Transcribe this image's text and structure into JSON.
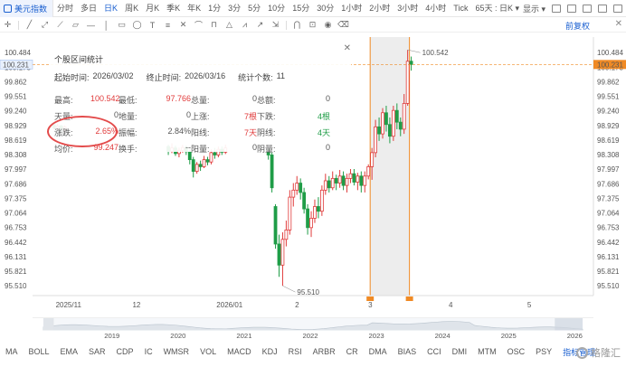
{
  "topbar": {
    "symbol": "美元指数",
    "periods": [
      {
        "label": "分时",
        "active": false
      },
      {
        "label": "多日",
        "active": false
      },
      {
        "label": "日K",
        "active": true
      },
      {
        "label": "周K",
        "active": false
      },
      {
        "label": "月K",
        "active": false
      },
      {
        "label": "季K",
        "active": false
      },
      {
        "label": "年K",
        "active": false
      },
      {
        "label": "1分",
        "active": false
      },
      {
        "label": "3分",
        "active": false
      },
      {
        "label": "5分",
        "active": false
      },
      {
        "label": "10分",
        "active": false
      },
      {
        "label": "15分",
        "active": false
      },
      {
        "label": "30分",
        "active": false
      },
      {
        "label": "1小时",
        "active": false
      },
      {
        "label": "2小时",
        "active": false
      },
      {
        "label": "3小时",
        "active": false
      },
      {
        "label": "4小时",
        "active": false
      },
      {
        "label": "Tick",
        "active": false
      },
      {
        "label": "65天 : 日K ▾",
        "active": false
      }
    ],
    "display_label": "显示 ▾"
  },
  "toolbar": {
    "fuquan_label": "前复权"
  },
  "stats_panel": {
    "title": "个股区间统计",
    "start_label": "起始时间:",
    "start_value": "2026/03/02",
    "end_label": "终止时间:",
    "end_value": "2026/03/16",
    "count_label": "统计个数:",
    "count_value": "11",
    "rows": [
      [
        {
          "k": "最高:",
          "v": "100.542",
          "c": "red"
        },
        {
          "k": "最低:",
          "v": "97.766",
          "c": "red"
        },
        {
          "k": "总量:",
          "v": "0",
          "c": ""
        },
        {
          "k": "总额:",
          "v": "0",
          "c": ""
        }
      ],
      [
        {
          "k": "天量:",
          "v": "0",
          "c": ""
        },
        {
          "k": "地量:",
          "v": "0",
          "c": ""
        },
        {
          "k": "上涨:",
          "v": "7根",
          "c": "red"
        },
        {
          "k": "下跌:",
          "v": "4根",
          "c": "green"
        }
      ],
      [
        {
          "k": "涨跌:",
          "v": "2.65%",
          "c": "red"
        },
        {
          "k": "振幅:",
          "v": "2.84%",
          "c": ""
        },
        {
          "k": "阳线:",
          "v": "7天",
          "c": "red"
        },
        {
          "k": "阴线:",
          "v": "4天",
          "c": "green"
        }
      ],
      [
        {
          "k": "均价:",
          "v": "99.247",
          "c": "red"
        },
        {
          "k": "换手:",
          "v": "--",
          "c": ""
        },
        {
          "k": "阳量:",
          "v": "0",
          "c": ""
        },
        {
          "k": "阴量:",
          "v": "0",
          "c": ""
        }
      ]
    ]
  },
  "chart_data": {
    "type": "candlestick",
    "y_ticks": [
      "100.484",
      "100.173",
      "99.862",
      "99.551",
      "99.240",
      "98.929",
      "98.619",
      "98.308",
      "97.997",
      "97.686",
      "97.375",
      "97.064",
      "96.753",
      "96.442",
      "96.131",
      "95.821",
      "95.510"
    ],
    "ylim": [
      95.3,
      100.7
    ],
    "current_price": "100.231",
    "high_label": "100.542",
    "low_label": "95.510",
    "x_labels": [
      {
        "label": "2025/11",
        "x": 0
      },
      {
        "label": "12",
        "x": 21.5
      },
      {
        "label": "2026/01",
        "x": 45
      },
      {
        "label": "2",
        "x": 67
      },
      {
        "label": "3",
        "x": 87.5
      },
      {
        "label": "4",
        "x": 110
      },
      {
        "label": "5",
        "x": 132
      }
    ],
    "xlim": [
      -8,
      149
    ],
    "candles": [
      [
        -2,
        98.95,
        98.88,
        98.97,
        98.85
      ],
      [
        -1,
        98.88,
        98.92,
        98.96,
        98.83
      ],
      [
        0,
        98.92,
        98.85,
        98.94,
        98.8
      ],
      [
        1,
        98.85,
        98.9,
        98.93,
        98.78
      ],
      [
        30,
        98.48,
        98.38,
        98.52,
        98.3
      ],
      [
        31,
        98.38,
        98.45,
        98.55,
        98.34
      ],
      [
        32,
        98.45,
        98.33,
        98.5,
        98.28
      ],
      [
        33,
        98.33,
        98.4,
        98.46,
        98.25
      ],
      [
        34,
        98.4,
        98.46,
        98.52,
        98.35
      ],
      [
        35,
        98.46,
        98.37,
        98.5,
        98.3
      ],
      [
        36,
        98.37,
        98.2,
        98.42,
        98.1
      ],
      [
        37,
        98.2,
        97.95,
        98.26,
        97.82
      ],
      [
        38,
        97.95,
        98.1,
        98.15,
        97.9
      ],
      [
        39,
        98.1,
        98.05,
        98.18,
        97.96
      ],
      [
        40,
        98.05,
        98.2,
        98.28,
        98.02
      ],
      [
        41,
        98.2,
        98.15,
        98.26,
        98.08
      ],
      [
        42,
        98.15,
        98.35,
        98.42,
        98.1
      ],
      [
        43,
        98.35,
        98.3,
        98.45,
        98.22
      ],
      [
        44,
        98.3,
        98.42,
        98.48,
        98.25
      ],
      [
        45,
        98.42,
        98.36,
        98.48,
        98.3
      ],
      [
        46,
        98.36,
        98.45,
        98.52,
        98.32
      ],
      [
        58,
        98.4,
        98.3,
        98.45,
        98.2
      ],
      [
        59,
        98.3,
        97.6,
        98.35,
        97.5
      ],
      [
        60,
        97.2,
        96.4,
        97.25,
        96.3
      ],
      [
        61,
        96.4,
        95.95,
        96.6,
        95.7
      ],
      [
        62,
        95.95,
        96.5,
        96.65,
        95.51
      ],
      [
        63,
        96.5,
        96.7,
        96.9,
        96.35
      ],
      [
        64,
        96.7,
        97.4,
        97.55,
        96.6
      ],
      [
        65,
        97.4,
        97.55,
        97.7,
        97.2
      ],
      [
        66,
        97.55,
        97.7,
        97.85,
        97.45
      ],
      [
        67,
        97.7,
        97.5,
        97.8,
        97.35
      ],
      [
        68,
        97.5,
        97.15,
        97.6,
        97.05
      ],
      [
        69,
        97.15,
        96.75,
        97.25,
        96.6
      ],
      [
        70,
        96.75,
        96.95,
        97.1,
        96.55
      ],
      [
        71,
        96.95,
        97.2,
        97.35,
        96.85
      ],
      [
        72,
        97.2,
        97.1,
        97.4,
        96.95
      ],
      [
        73,
        97.1,
        97.55,
        97.65,
        97.0
      ],
      [
        74,
        97.55,
        97.75,
        97.9,
        97.45
      ],
      [
        75,
        97.75,
        97.6,
        97.85,
        97.5
      ],
      [
        76,
        97.6,
        97.8,
        97.95,
        97.55
      ],
      [
        77,
        97.8,
        97.7,
        97.88,
        97.55
      ],
      [
        78,
        97.7,
        97.85,
        97.98,
        97.6
      ],
      [
        79,
        97.85,
        97.65,
        97.95,
        97.55
      ],
      [
        80,
        97.65,
        97.8,
        97.9,
        97.5
      ],
      [
        81,
        97.8,
        97.9,
        98.0,
        97.7
      ],
      [
        82,
        97.9,
        97.72,
        98.0,
        97.65
      ],
      [
        83,
        97.72,
        97.85,
        97.92,
        97.55
      ],
      [
        84,
        97.85,
        97.65,
        97.95,
        97.5
      ],
      [
        85,
        97.65,
        97.85,
        97.95,
        97.5
      ],
      [
        86,
        97.85,
        98.05,
        98.1,
        97.78
      ],
      [
        87,
        98.05,
        98.35,
        98.45,
        97.77
      ],
      [
        88,
        98.35,
        98.9,
        99.05,
        98.25
      ],
      [
        89,
        98.9,
        98.75,
        99.1,
        98.6
      ],
      [
        90,
        98.75,
        99.2,
        99.3,
        98.65
      ],
      [
        91,
        99.2,
        98.95,
        99.35,
        98.8
      ],
      [
        92,
        98.95,
        98.7,
        99.1,
        98.55
      ],
      [
        93,
        98.7,
        99.25,
        99.35,
        98.6
      ],
      [
        94,
        99.25,
        99.0,
        99.4,
        98.85
      ],
      [
        95,
        99.0,
        98.85,
        99.1,
        98.7
      ],
      [
        96,
        98.85,
        99.4,
        99.6,
        98.75
      ],
      [
        97,
        99.4,
        100.3,
        100.542,
        99.35
      ],
      [
        98,
        100.3,
        100.231,
        100.4,
        100.1
      ]
    ],
    "selection_range": [
      86.5,
      97.5
    ],
    "navigator_years": [
      "2019",
      "2020",
      "2021",
      "2022",
      "2023",
      "2024",
      "2025",
      "2026"
    ]
  },
  "bottombar": {
    "indicators": [
      {
        "label": "MA",
        "active": false
      },
      {
        "label": "BOLL",
        "active": false
      },
      {
        "label": "EMA",
        "active": false
      },
      {
        "label": "SAR",
        "active": false
      },
      {
        "label": "CDP",
        "active": false
      },
      {
        "label": "IC",
        "active": false
      },
      {
        "label": "WMSR",
        "active": false
      },
      {
        "label": "VOL",
        "active": false
      },
      {
        "label": "MACD",
        "active": false
      },
      {
        "label": "KDJ",
        "active": false
      },
      {
        "label": "RSI",
        "active": false
      },
      {
        "label": "ARBR",
        "active": false
      },
      {
        "label": "CR",
        "active": false
      },
      {
        "label": "DMA",
        "active": false
      },
      {
        "label": "BIAS",
        "active": false
      },
      {
        "label": "CCI",
        "active": false
      },
      {
        "label": "DMI",
        "active": false
      },
      {
        "label": "MTM",
        "active": false
      },
      {
        "label": "OSC",
        "active": false
      },
      {
        "label": "PSY",
        "active": false
      },
      {
        "label": "指标管理",
        "active": true
      }
    ],
    "logo_text": "格隆汇"
  },
  "colors": {
    "up": "#e03a3a",
    "down": "#1f9d47",
    "accent": "#1a5fd0",
    "selection": "#f08a24"
  }
}
